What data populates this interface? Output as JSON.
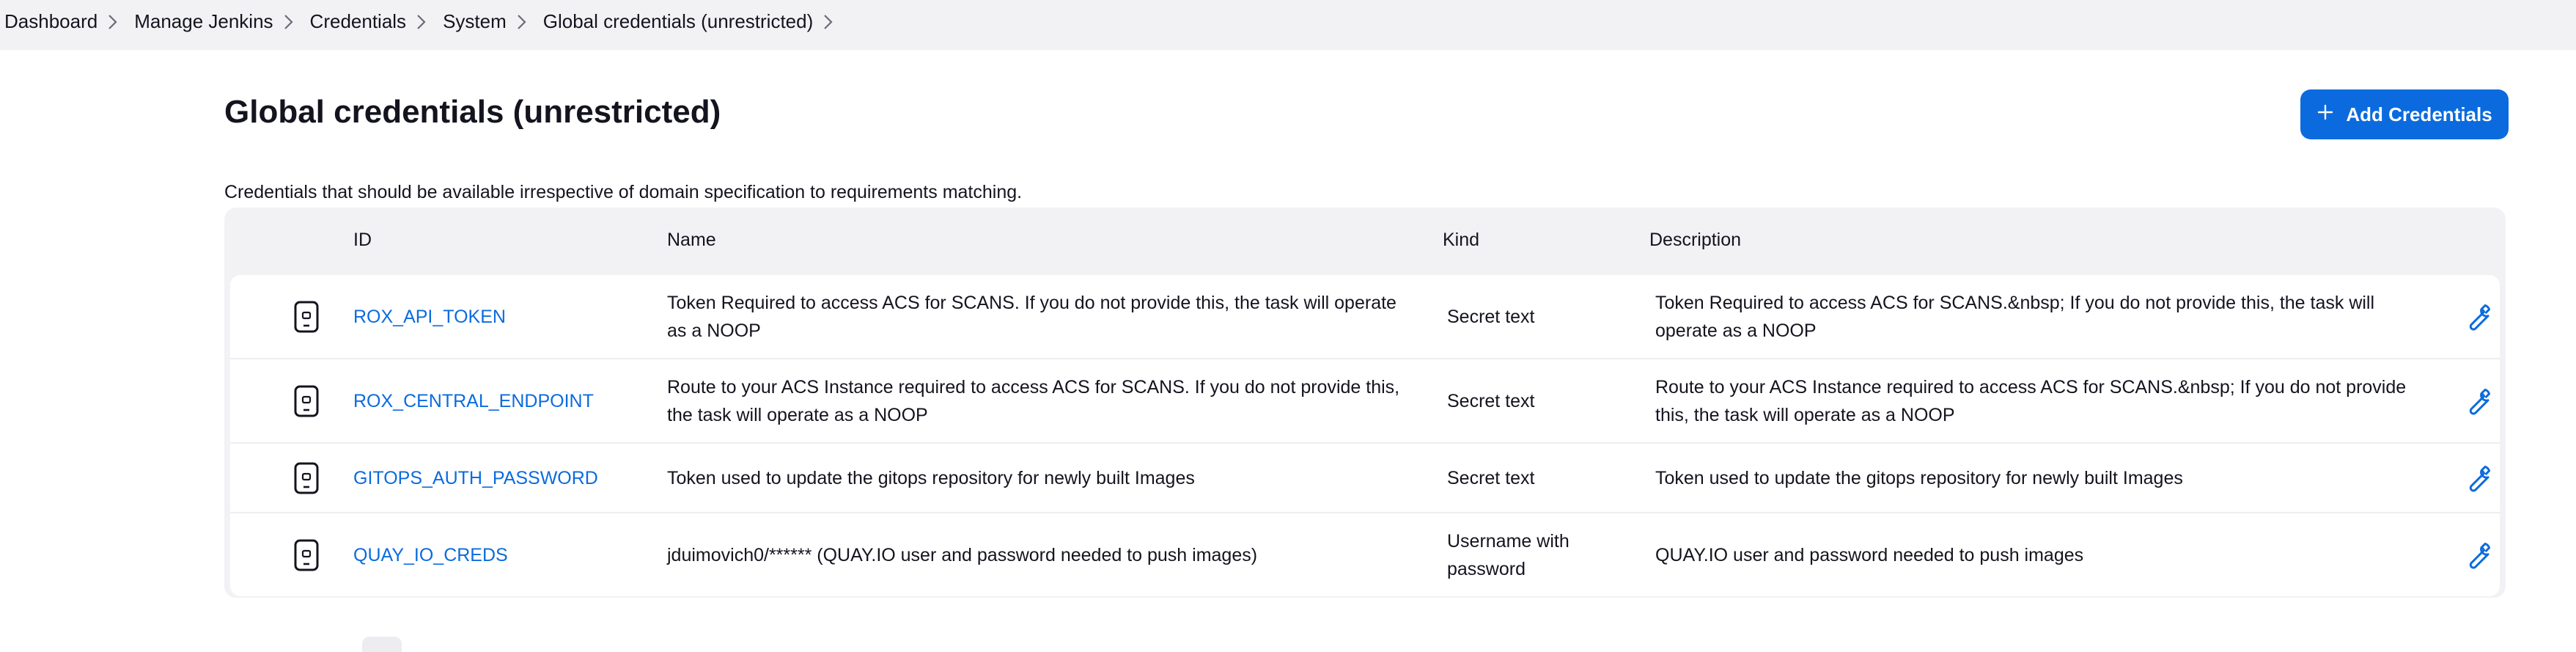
{
  "breadcrumb": [
    {
      "label": "Dashboard"
    },
    {
      "label": "Manage Jenkins"
    },
    {
      "label": "Credentials"
    },
    {
      "label": "System"
    },
    {
      "label": "Global credentials (unrestricted)"
    }
  ],
  "page": {
    "title": "Global credentials (unrestricted)",
    "add_button_label": "Add Credentials",
    "description": "Credentials that should be available irrespective of domain specification to requirements matching."
  },
  "table": {
    "headers": {
      "id": "ID",
      "name": "Name",
      "kind": "Kind",
      "description": "Description"
    },
    "rows": [
      {
        "id": "ROX_API_TOKEN",
        "name": "Token Required to access ACS for SCANS. If you do not provide this, the task will operate as a NOOP",
        "kind": "Secret text",
        "description": "Token Required to access ACS for SCANS.&nbsp; If you do not provide this, the task will operate as a NOOP"
      },
      {
        "id": "ROX_CENTRAL_ENDPOINT",
        "name": "Route to your ACS Instance required to access ACS for SCANS. If you do not provide this, the task will operate as a NOOP",
        "kind": "Secret text",
        "description": "Route to your ACS Instance required to access ACS for SCANS.&nbsp; If you do not provide this, the task will operate as a NOOP"
      },
      {
        "id": "GITOPS_AUTH_PASSWORD",
        "name": "Token used to update the gitops repository for newly built Images",
        "kind": "Secret text",
        "description": "Token used to update the gitops repository for newly built Images"
      },
      {
        "id": "QUAY_IO_CREDS",
        "name": "jduimovich0/****** (QUAY.IO user and password needed to push images)",
        "kind": "Username with password",
        "description": "QUAY.IO user and password needed to push images"
      }
    ]
  },
  "icons": {
    "row_type": "mobile-phone-icon",
    "row_action": "wrench-icon",
    "add": "plus-icon",
    "separator": "chevron-right-icon"
  },
  "colors": {
    "accent": "#0b6bde",
    "breadcrumb_bg": "#f2f2f5",
    "table_bg": "#f2f2f5"
  }
}
